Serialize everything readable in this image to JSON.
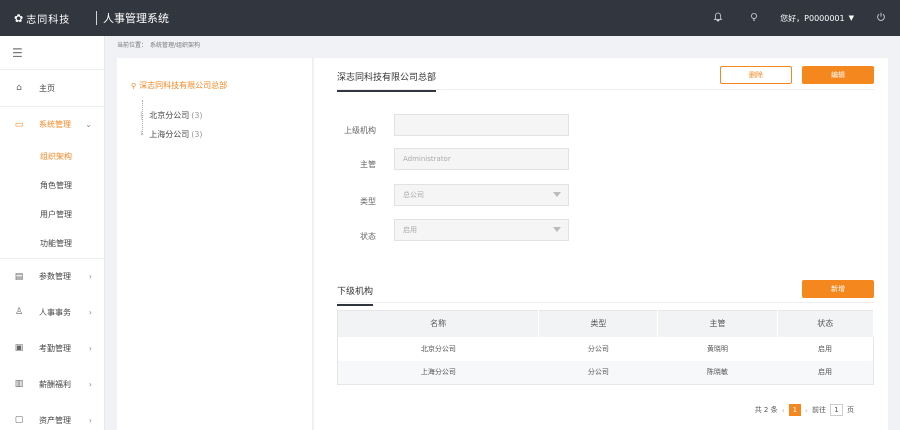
{
  "header": {
    "logo_text": "志同科技",
    "system_title": "人事管理系统",
    "greeting": "您好，P0000001"
  },
  "sidebar": {
    "items": [
      {
        "label": "主页",
        "icon": "home-icon"
      },
      {
        "label": "系统管理",
        "icon": "monitor-icon"
      },
      {
        "label": "参数管理",
        "icon": "document-icon"
      },
      {
        "label": "人事事务",
        "icon": "users-icon"
      },
      {
        "label": "考勤管理",
        "icon": "calendar-icon"
      },
      {
        "label": "薪酬福利",
        "icon": "book-icon"
      },
      {
        "label": "资产管理",
        "icon": "screen-icon"
      }
    ],
    "sub_items": [
      {
        "label": "组织架构"
      },
      {
        "label": "角色管理"
      },
      {
        "label": "用户管理"
      },
      {
        "label": "功能管理"
      }
    ]
  },
  "breadcrumb": {
    "prefix": "当前位置：",
    "path": "系统管理/组织架构"
  },
  "tree": {
    "root": "深志同科技有限公司总部",
    "children": [
      {
        "name": "北京分公司",
        "count": "(3)"
      },
      {
        "name": "上海分公司",
        "count": "(3)"
      }
    ]
  },
  "main": {
    "tab_title": "深志同科技有限公司总部",
    "delete_label": "删除",
    "edit_label": "编辑",
    "form": {
      "parent_label": "上级机构",
      "parent_value": "",
      "manager_label": "主管",
      "manager_value": "Administrator",
      "type_label": "类型",
      "type_value": "总公司",
      "status_label": "状态",
      "status_value": "启用"
    },
    "sub_tab_title": "下级机构",
    "add_label": "新增",
    "table": {
      "columns": [
        "名称",
        "类型",
        "主管",
        "状态"
      ],
      "rows": [
        [
          "北京分公司",
          "分公司",
          "黄晓明",
          "启用"
        ],
        [
          "上海分公司",
          "分公司",
          "陈晓敏",
          "启用"
        ]
      ]
    },
    "pager": {
      "total": "共 2 条",
      "current": "1",
      "goto_label": "前往",
      "goto_value": "1",
      "page_unit": "页"
    }
  },
  "colors": {
    "accent": "#f5871f",
    "topbar": "#32363f"
  }
}
